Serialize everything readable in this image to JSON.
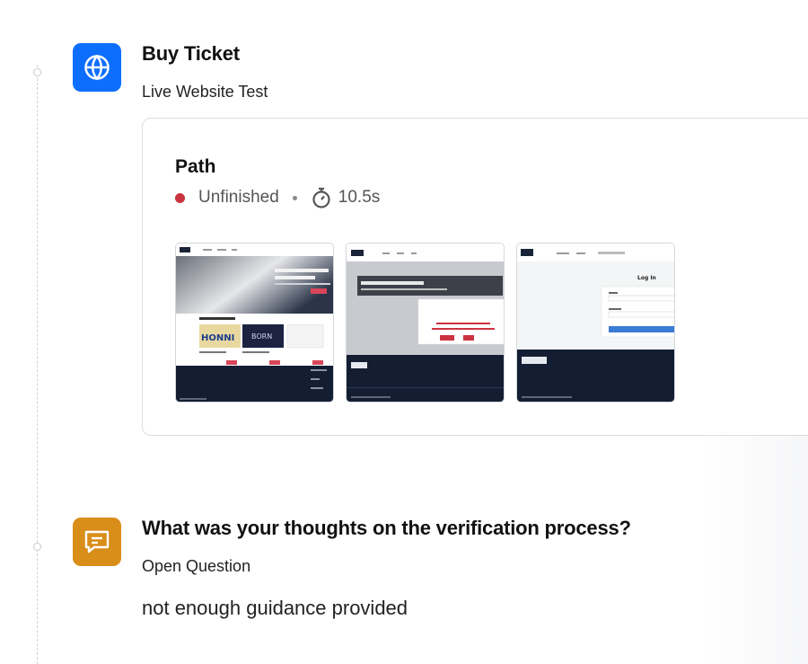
{
  "step1": {
    "title": "Buy Ticket",
    "type_label": "Live Website Test",
    "icon": "globe-icon",
    "icon_color": "#0d6efd",
    "card": {
      "title": "Path",
      "status": "Unfinished",
      "status_color": "#cc3340",
      "duration": "10.5s",
      "thumbnails": [
        {
          "label": "THE ... coming to Singapore",
          "section": "Upcoming Events",
          "poster1": "HONNI",
          "poster2": "BORN"
        },
        {
          "label": "All That Was Seat Your",
          "dialog": ""
        },
        {
          "label": "Log In"
        }
      ]
    }
  },
  "step2": {
    "title": "What was your thoughts on the verification process?",
    "type_label": "Open Question",
    "icon": "message-icon",
    "icon_color": "#d98e1a",
    "answer": "not enough guidance provided"
  }
}
